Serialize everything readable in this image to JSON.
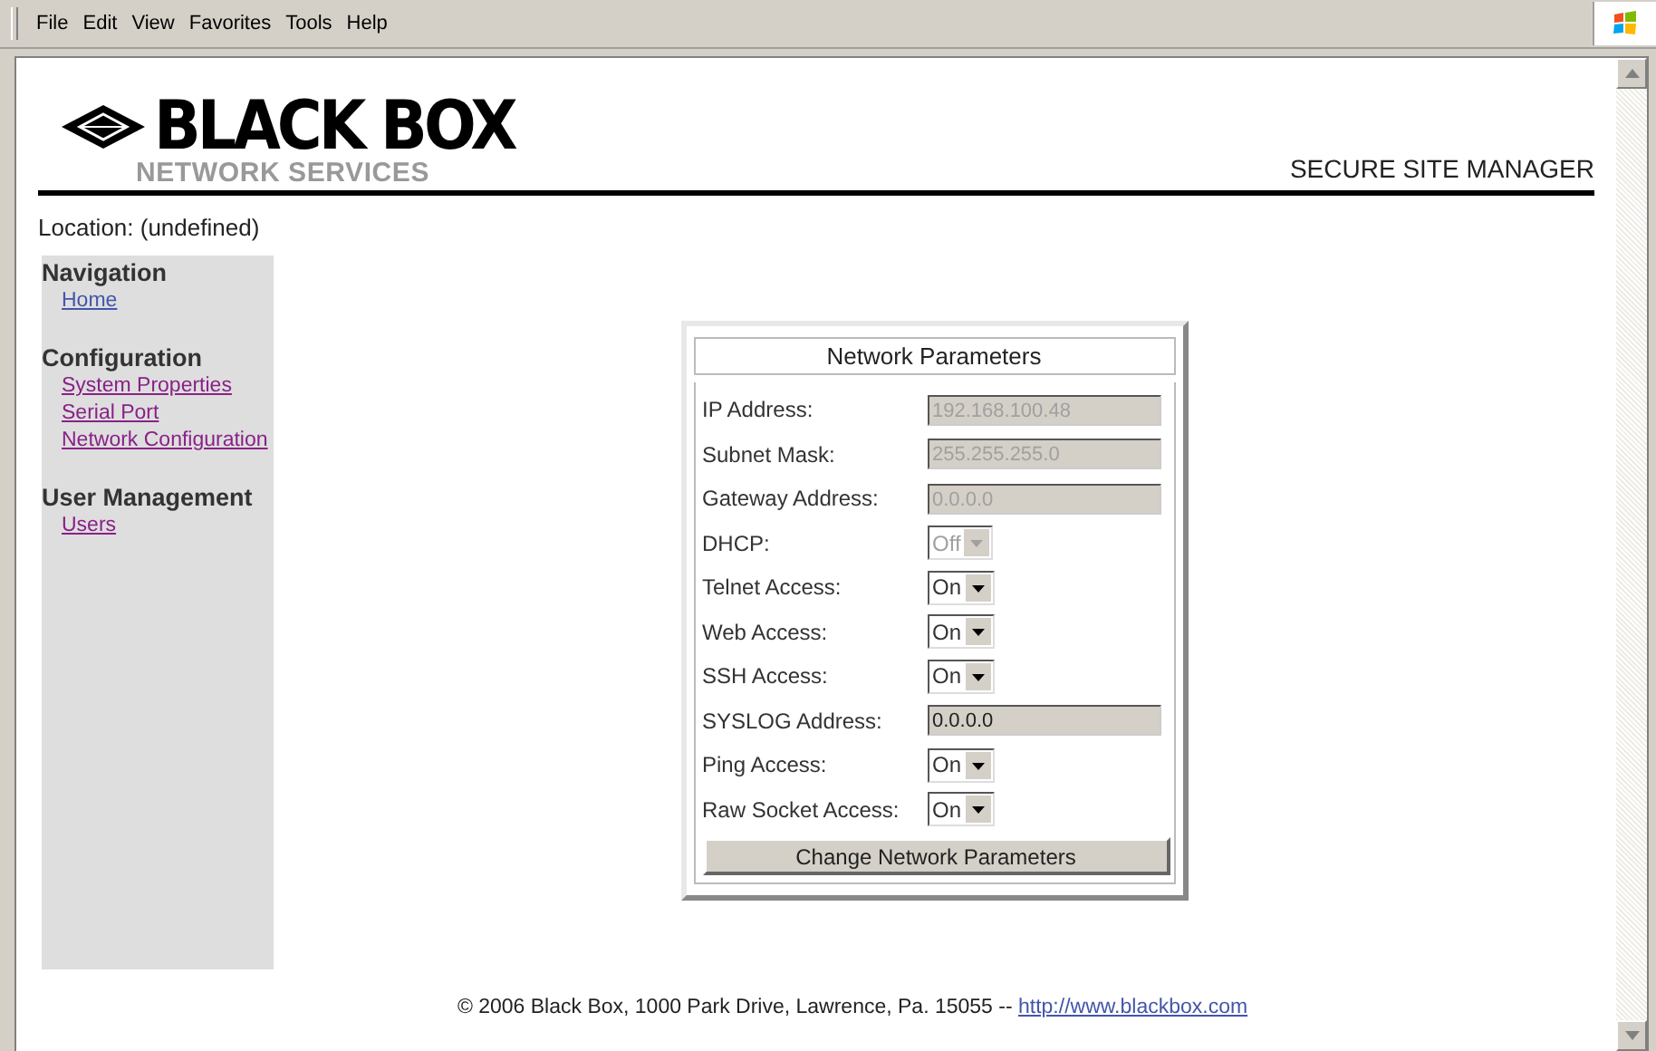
{
  "menu_bar": [
    "File",
    "Edit",
    "View",
    "Favorites",
    "Tools",
    "Help"
  ],
  "header": {
    "logo_title": "BLACK BOX",
    "logo_subtitle": "NETWORK SERVICES",
    "app_title": "SECURE SITE MANAGER"
  },
  "location": "Location: (undefined)",
  "sidebar": {
    "sections": [
      {
        "title": "Navigation",
        "links": [
          {
            "label": "Home",
            "visited": false
          }
        ]
      },
      {
        "title": "Configuration",
        "links": [
          {
            "label": "System Properties",
            "visited": true
          },
          {
            "label": "Serial Port",
            "visited": true
          },
          {
            "label": "Network Configuration",
            "visited": true
          }
        ]
      },
      {
        "title": "User Management",
        "links": [
          {
            "label": "Users",
            "visited": true
          }
        ]
      }
    ]
  },
  "panel": {
    "title": "Network Parameters",
    "fields": [
      {
        "label": "IP Address:",
        "kind": "text",
        "value": "192.168.100.48",
        "disabled": true
      },
      {
        "label": "Subnet Mask:",
        "kind": "text",
        "value": "255.255.255.0",
        "disabled": true
      },
      {
        "label": "Gateway Address:",
        "kind": "text",
        "value": "0.0.0.0",
        "disabled": true
      },
      {
        "label": "DHCP:",
        "kind": "select",
        "value": "Off",
        "disabled": true
      },
      {
        "label": "Telnet Access:",
        "kind": "select",
        "value": "On",
        "disabled": false
      },
      {
        "label": "Web Access:",
        "kind": "select",
        "value": "On",
        "disabled": false
      },
      {
        "label": "SSH Access:",
        "kind": "select",
        "value": "On",
        "disabled": false
      },
      {
        "label": "SYSLOG Address:",
        "kind": "text",
        "value": "0.0.0.0",
        "disabled": false
      },
      {
        "label": "Ping Access:",
        "kind": "select",
        "value": "On",
        "disabled": false
      },
      {
        "label": "Raw Socket Access:",
        "kind": "select",
        "value": "On",
        "disabled": false
      }
    ],
    "button": "Change Network Parameters"
  },
  "footer": {
    "text": "© 2006 Black Box, 1000 Park Drive, Lawrence, Pa. 15055 --",
    "link": "http://www.blackbox.com"
  }
}
